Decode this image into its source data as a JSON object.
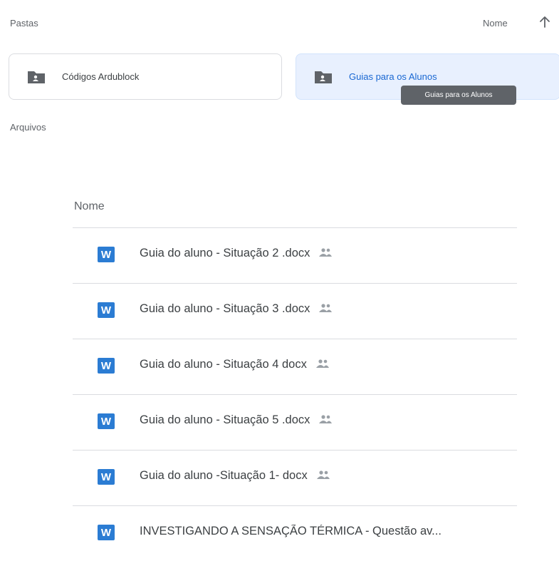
{
  "folders_section": {
    "label": "Pastas"
  },
  "sort": {
    "label": "Nome",
    "direction": "ascending"
  },
  "folders": [
    {
      "name": "Códigos Ardublock",
      "selected": false
    },
    {
      "name": "Guias para os Alunos",
      "selected": true
    }
  ],
  "tooltip": {
    "text": "Guias para os Alunos"
  },
  "files_section": {
    "label": "Arquivos"
  },
  "list": {
    "header": "Nome",
    "files": [
      {
        "name": "Guia do aluno - Situação 2 .docx",
        "icon": "word-icon",
        "shared": true
      },
      {
        "name": "Guia do aluno - Situação 3 .docx",
        "icon": "word-icon",
        "shared": true
      },
      {
        "name": "Guia do aluno - Situação 4 docx",
        "icon": "word-icon",
        "shared": true
      },
      {
        "name": "Guia do aluno - Situação 5 .docx",
        "icon": "word-icon",
        "shared": true
      },
      {
        "name": "Guia do aluno -Situação 1- docx",
        "icon": "word-icon",
        "shared": true
      },
      {
        "name": "INVESTIGANDO A SENSAÇÃO TÉRMICA - Questão av...",
        "icon": "word-icon",
        "shared": false
      }
    ]
  },
  "word_icon_letter": "W",
  "colors": {
    "selected_folder_bg": "#e8f0fe",
    "selected_folder_text": "#1967d2",
    "word_blue": "#2b7cd3",
    "tooltip_bg": "#5f6368"
  }
}
